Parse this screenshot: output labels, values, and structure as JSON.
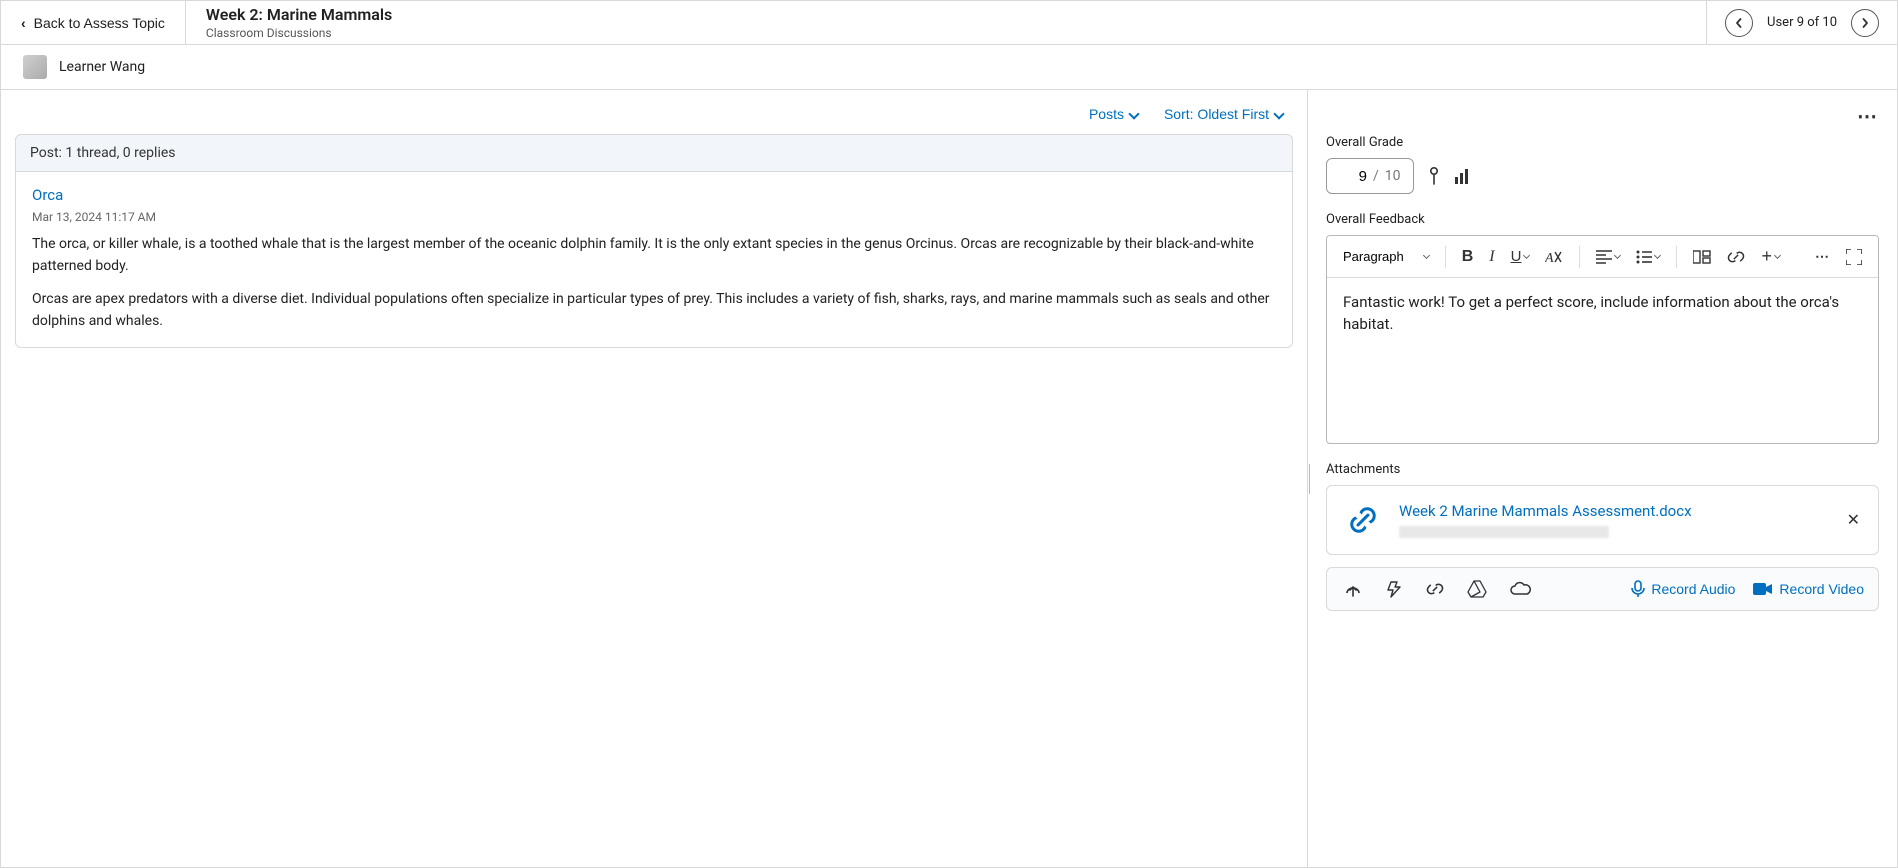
{
  "header": {
    "back_label": "Back to Assess Topic",
    "title": "Week 2: Marine Mammals",
    "subtitle": "Classroom Discussions",
    "user_count": "User 9 of 10"
  },
  "learner": {
    "name": "Learner Wang"
  },
  "posts_controls": {
    "posts_label": "Posts",
    "sort_label": "Sort: Oldest First"
  },
  "posts_summary": "Post: 1 thread, 0 replies",
  "post": {
    "title": "Orca",
    "date": "Mar 13, 2024 11:17 AM",
    "para1": "The orca, or killer whale, is a toothed whale that is the largest member of the oceanic dolphin family. It is the only extant species in the genus Orcinus. Orcas are recognizable by their black-and-white patterned body.",
    "para2": "Orcas are apex predators with a diverse diet. Individual populations often specialize in particular types of prey. This includes a variety of fish, sharks, rays, and marine mammals such as seals and other dolphins and whales."
  },
  "grade": {
    "label": "Overall Grade",
    "value": "9",
    "denom": "10"
  },
  "feedback": {
    "label": "Overall Feedback",
    "paragraph_label": "Paragraph",
    "text": "Fantastic work! To get a perfect score, include information about the orca's habitat."
  },
  "attachments": {
    "label": "Attachments",
    "file_name": "Week 2 Marine Mammals Assessment.docx"
  },
  "actions": {
    "record_audio": "Record Audio",
    "record_video": "Record Video"
  }
}
